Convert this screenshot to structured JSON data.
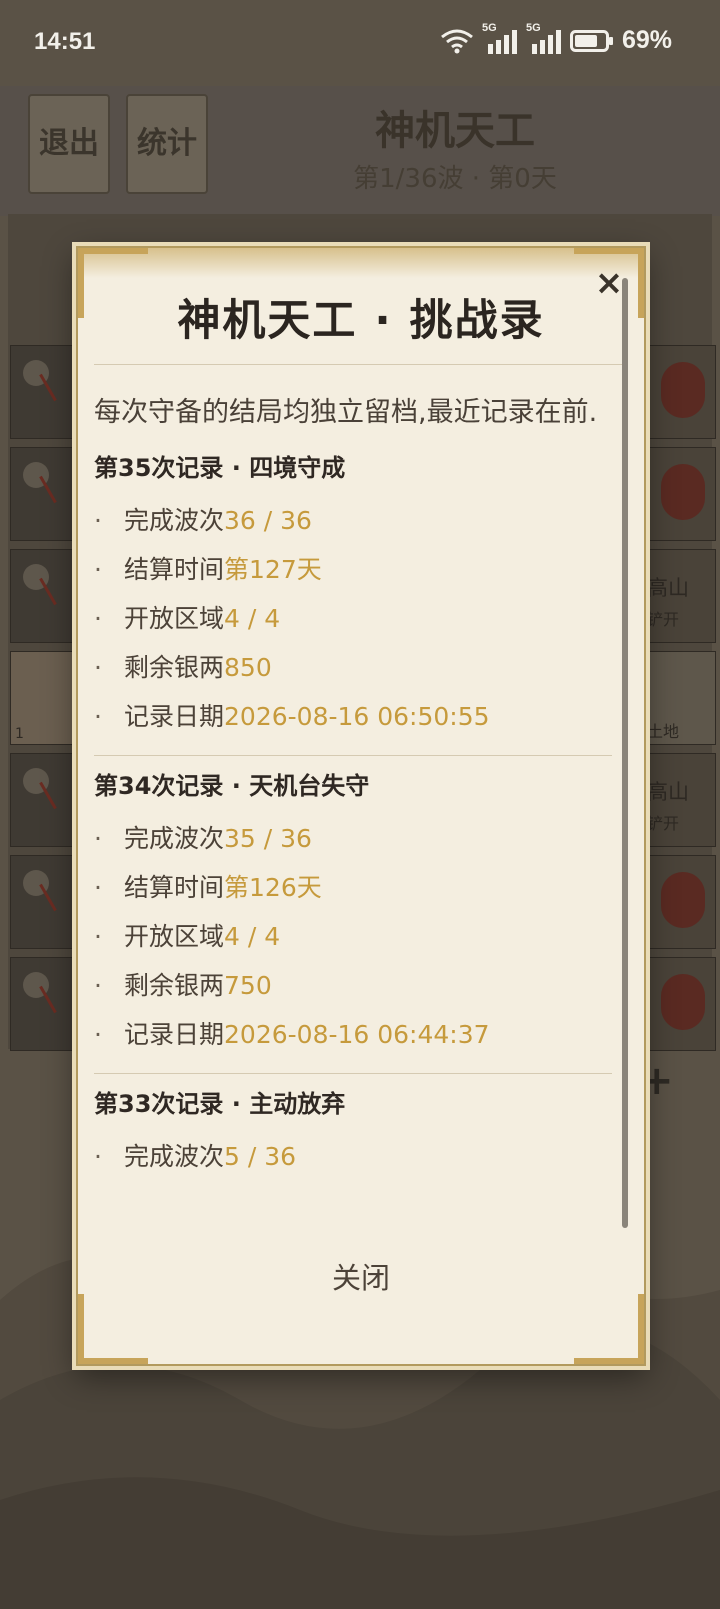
{
  "status_bar": {
    "time": "14:51",
    "signal1_label": "5G",
    "signal2_label": "5G",
    "battery": "69%"
  },
  "game_header": {
    "exit_label": "退出",
    "stats_label": "统计",
    "title": "神机天工",
    "subtitle": "第1/36波 · 第0天"
  },
  "board": {
    "right_tiles": [
      {
        "line1": "高山",
        "line2": "铲开"
      },
      {
        "line1": "",
        "line2": "土地"
      },
      {
        "line1": "高山",
        "line2": "铲开"
      }
    ],
    "left_special_count": "1"
  },
  "modal": {
    "title": "神机天工 · 挑战录",
    "intro": "每次守备的结局均独立留档,最近记录在前.",
    "close_x": "×",
    "close_button": "关闭",
    "records": [
      {
        "heading": "第35次记录 · 四境守成",
        "rows": [
          {
            "label": "完成波次",
            "value": "36 / 36"
          },
          {
            "label": "结算时间",
            "value": "第127天"
          },
          {
            "label": "开放区域",
            "value": "4 / 4"
          },
          {
            "label": "剩余银两",
            "value": "850"
          },
          {
            "label": "记录日期",
            "value": "2026-08-16 06:50:55"
          }
        ]
      },
      {
        "heading": "第34次记录 · 天机台失守",
        "rows": [
          {
            "label": "完成波次",
            "value": "35 / 36"
          },
          {
            "label": "结算时间",
            "value": "第126天"
          },
          {
            "label": "开放区域",
            "value": "4 / 4"
          },
          {
            "label": "剩余银两",
            "value": "750"
          },
          {
            "label": "记录日期",
            "value": "2026-08-16 06:44:37"
          }
        ]
      },
      {
        "heading": "第33次记录 · 主动放弃",
        "rows": [
          {
            "label": "完成波次",
            "value": "5 / 36"
          }
        ]
      }
    ]
  },
  "colors": {
    "modal_bg": "#f4eee0",
    "accent_value": "#c69a3c",
    "frame_gold": "#c7a45a",
    "overlay_bg": "#5a5246"
  }
}
